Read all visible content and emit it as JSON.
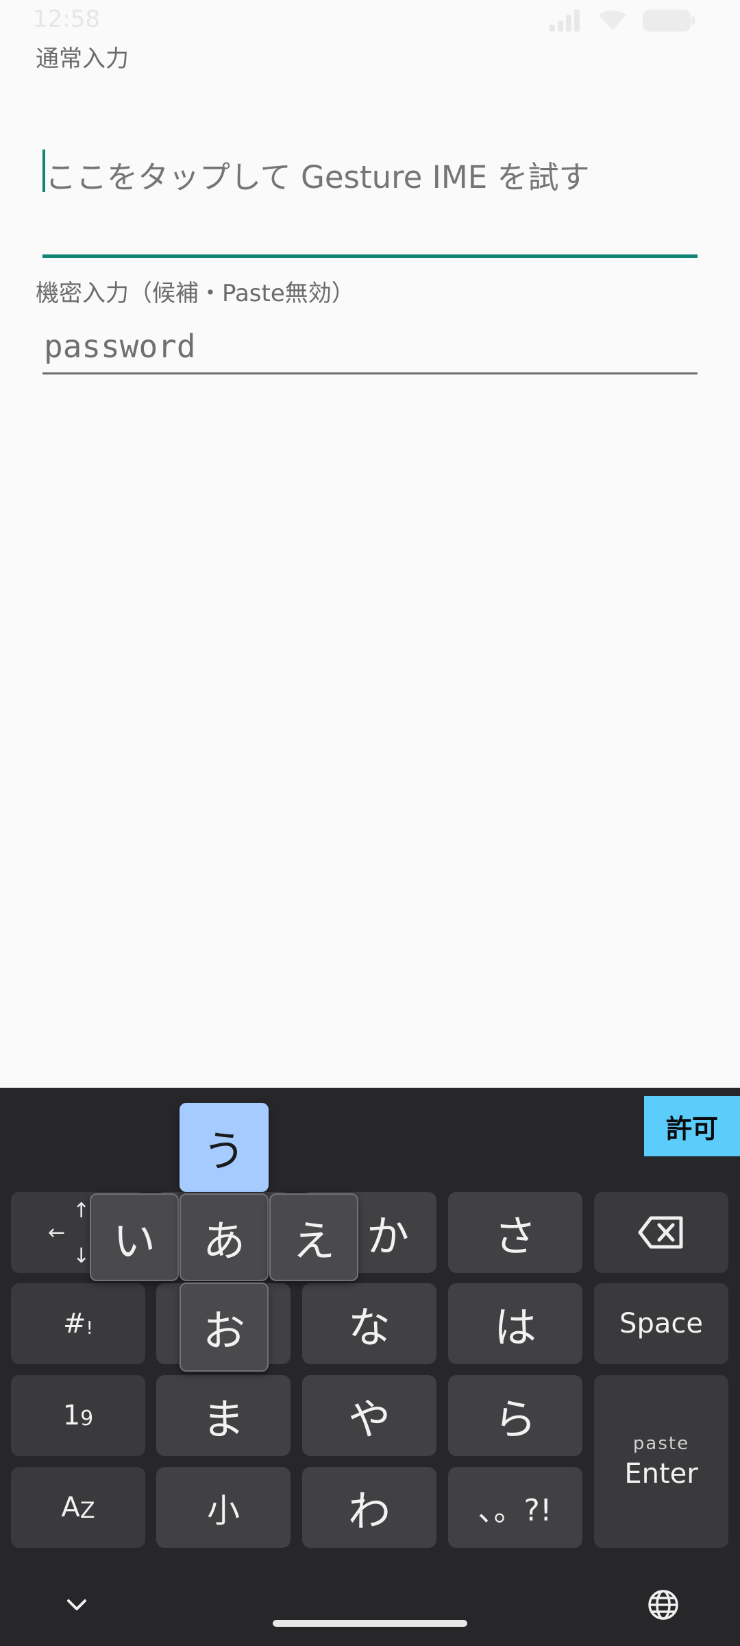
{
  "status_bar": {
    "time": "12:58",
    "icons": [
      "signal-icon",
      "wifi-icon",
      "battery-icon"
    ]
  },
  "form": {
    "normal_label": "通常入力",
    "normal_placeholder": "ここをタップして Gesture IME を試す",
    "secret_label": "機密入力（候補・Paste無効）",
    "password_placeholder": "password"
  },
  "keyboard": {
    "allow_button": "許可",
    "arrows": {
      "up": "↑",
      "left": "←",
      "down": "↓"
    },
    "flick_popup": {
      "center": "あ",
      "left": "い",
      "up": "う",
      "right": "え",
      "down": "お"
    },
    "keys": {
      "ka": "か",
      "sa": "さ",
      "na": "な",
      "ha": "は",
      "ma": "ま",
      "ya": "や",
      "ra": "ら",
      "wa": "わ",
      "small": "小",
      "punct": "､。?!",
      "symbols_main": "#",
      "symbols_sub": "!",
      "numbers_main": "1",
      "numbers_sub": "9",
      "alpha_main": "A",
      "alpha_sub": "Z",
      "space": "Space",
      "paste": "paste",
      "enter": "Enter"
    },
    "bottom_icons": [
      "chevron-down-icon",
      "globe-icon"
    ]
  },
  "colors": {
    "accent": "#128575",
    "keyboard_bg": "#27272a",
    "key_bg": "#414143",
    "flick_active": "#a5cbff",
    "allow_bg": "#5ccdfb"
  }
}
